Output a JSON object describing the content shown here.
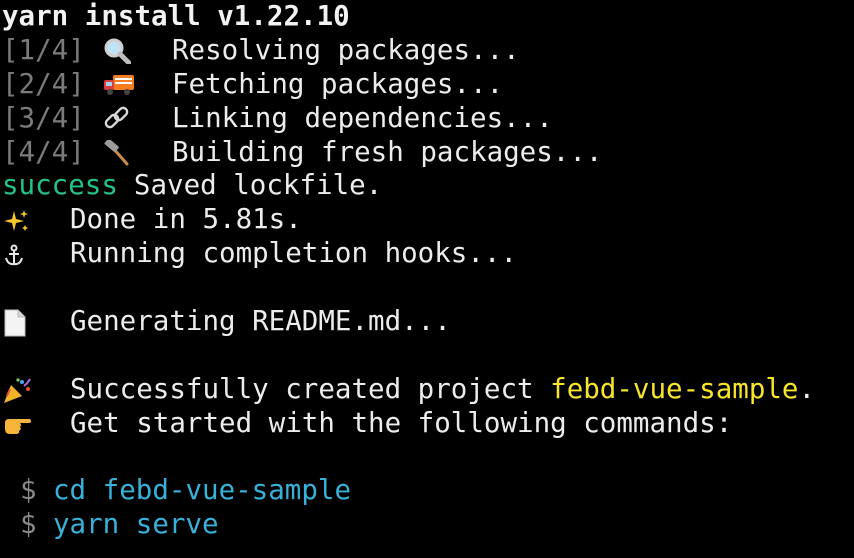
{
  "terminal": {
    "title": "yarn install v1.22.10",
    "steps": [
      {
        "prefix": "[1/4]",
        "icon": "magnifying-glass-icon",
        "text": "Resolving packages..."
      },
      {
        "prefix": "[2/4]",
        "icon": "delivery-truck-icon",
        "text": "Fetching packages..."
      },
      {
        "prefix": "[3/4]",
        "icon": "link-icon",
        "text": "Linking dependencies..."
      },
      {
        "prefix": "[4/4]",
        "icon": "hammer-icon",
        "text": "Building fresh packages..."
      }
    ],
    "success": {
      "tag": "success",
      "text": "Saved lockfile."
    },
    "done": {
      "icon": "sparkles-icon",
      "text": "Done in 5.81s."
    },
    "hooks": {
      "icon": "anchor-icon",
      "text": "Running completion hooks..."
    },
    "readme": {
      "icon": "document-icon",
      "text": "Generating README.md..."
    },
    "created": {
      "icon": "party-popper-icon",
      "text": "Successfully created project ",
      "project": "febd-vue-sample",
      "suffix": "."
    },
    "get_started": {
      "icon": "pointing-hand-icon",
      "text": "Get started with the following commands:"
    },
    "commands": [
      {
        "prompt": "$",
        "command": "cd febd-vue-sample"
      },
      {
        "prompt": "$",
        "command": "yarn serve"
      }
    ]
  },
  "colors": {
    "background": "#000000",
    "text": "#ececec",
    "step_prefix": "#7b7b7b",
    "success": "#22c387",
    "highlight": "#f6e52a",
    "command": "#38b0d8"
  }
}
